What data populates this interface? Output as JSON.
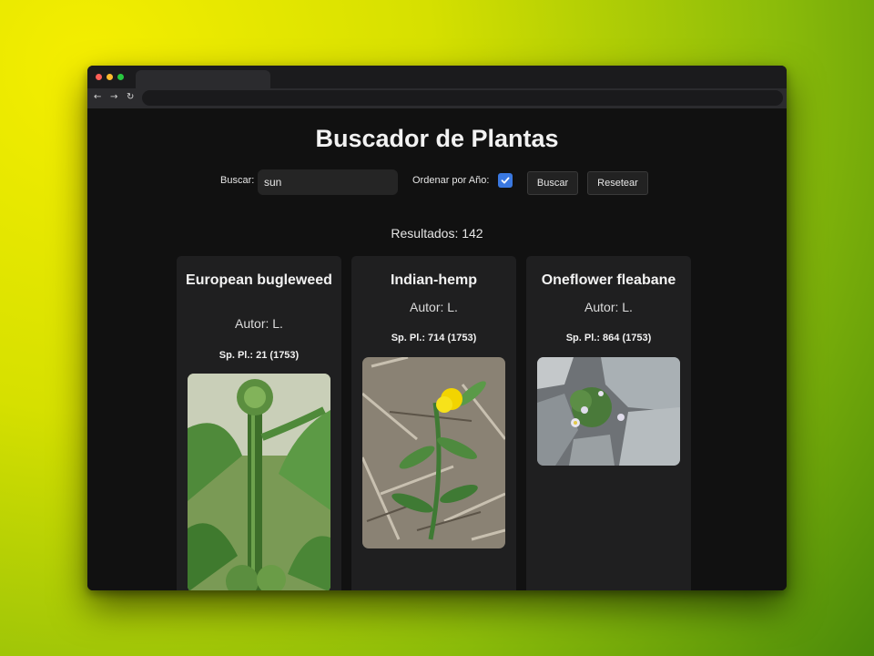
{
  "browser": {
    "dot_colors": [
      "#ff5f57",
      "#febc2e",
      "#28c840"
    ],
    "back_icon": "←",
    "forward_icon": "→",
    "reload_icon": "↻"
  },
  "page": {
    "title": "Buscador de Plantas",
    "search_label": "Buscar:",
    "search_value": "sun",
    "sort_label": "Ordenar por Año:",
    "sort_checked": true,
    "search_button": "Buscar",
    "reset_button": "Resetear",
    "results_text": "Resultados: 142"
  },
  "cards": [
    {
      "name": "European bugleweed",
      "author": "Autor: L.",
      "reference": "Sp. Pl.: 21 (1753)",
      "image": "plant-photo"
    },
    {
      "name": "Indian-hemp",
      "author": "Autor: L.",
      "reference": "Sp. Pl.: 714 (1753)",
      "image": "plant-photo"
    },
    {
      "name": "Oneflower fleabane",
      "author": "Autor: L.",
      "reference": "Sp. Pl.: 864 (1753)",
      "image": "plant-photo"
    }
  ]
}
